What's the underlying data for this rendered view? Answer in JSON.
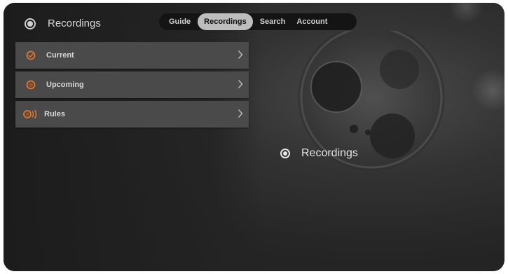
{
  "header": {
    "title": "Recordings",
    "icon": "radio-dot-icon"
  },
  "tabs": [
    {
      "label": "Guide",
      "active": false
    },
    {
      "label": "Recordings",
      "active": true
    },
    {
      "label": "Search",
      "active": false
    },
    {
      "label": "Account",
      "active": false
    }
  ],
  "menu": {
    "items": [
      {
        "label": "Current",
        "icon": "check-circle-icon"
      },
      {
        "label": "Upcoming",
        "icon": "record-circle-icon"
      },
      {
        "label": "Rules",
        "icon": "broadcast-record-icon"
      }
    ]
  },
  "detail": {
    "title": "Recordings",
    "icon": "radio-dot-icon"
  },
  "colors": {
    "accent": "#e0762c",
    "tab_active_bg": "#bdbdbd",
    "menu_item_bg": "#4a4a4a",
    "background": "#262626"
  }
}
